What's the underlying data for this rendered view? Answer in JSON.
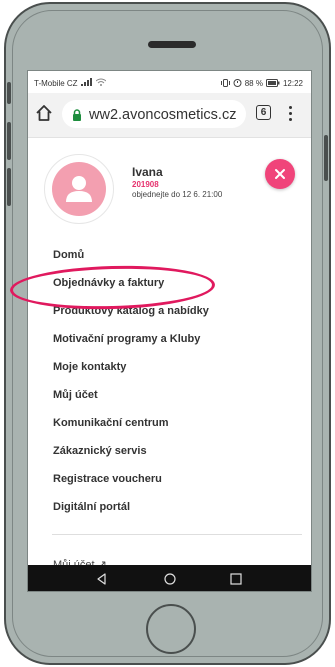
{
  "status_bar": {
    "carrier": "T-Mobile CZ",
    "battery": "88 %",
    "time": "12:22"
  },
  "browser": {
    "url": "ww2.avoncosmetics.cz",
    "tab_count": "6"
  },
  "profile": {
    "name": "Ivana",
    "account_number": "201908",
    "order_deadline": "objednejte do 12 6. 21:00"
  },
  "nav": {
    "items": [
      {
        "label": "Domů"
      },
      {
        "label": "Objednávky a faktury"
      },
      {
        "label": "Produktový katalog a nabídky"
      },
      {
        "label": "Motivační programy a Kluby"
      },
      {
        "label": "Moje kontakty"
      },
      {
        "label": "Můj účet"
      },
      {
        "label": "Komunikační centrum"
      },
      {
        "label": "Zákaznický servis"
      },
      {
        "label": "Registrace voucheru"
      },
      {
        "label": "Digitální portál"
      }
    ]
  },
  "footer": {
    "account_link": "Můj účet ↗"
  },
  "colors": {
    "accent": "#f0447a",
    "account_number": "#e6326e",
    "avatar": "#f39fb0",
    "annotation": "#e0195e"
  }
}
